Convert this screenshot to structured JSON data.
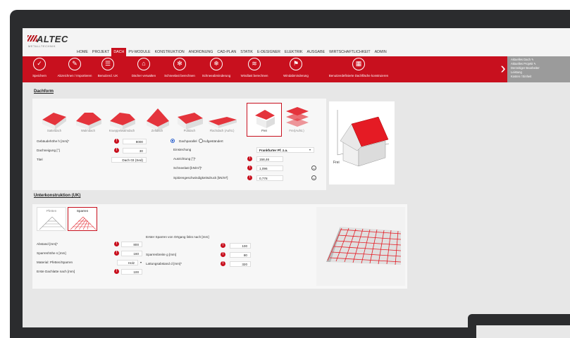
{
  "app": {
    "brand": "ALTEC",
    "brand_sub": "METALLTECHNIK"
  },
  "menu": [
    "HOME",
    "PROJEKT",
    "DACH",
    "PV-MODULE",
    "KONSTRUKTION",
    "ANORDNUNG",
    "CAD-PLAN",
    "STATIK",
    "E-DESIGNER",
    "ELEKTRIK",
    "AUSGABE",
    "WIRTSCHAFTLICHKEIT",
    "ADMIN"
  ],
  "menu_active": "DACH",
  "ribbon": [
    {
      "label": "Speichern",
      "icon": "✓"
    },
    {
      "label": "Abzeichnen / Importieren",
      "icon": "✎"
    },
    {
      "label": "Benutzerd. UK",
      "icon": "☰"
    },
    {
      "label": "Dächer verwalten",
      "icon": "⌂"
    },
    {
      "label": "Schneelast berechnen",
      "icon": "✻"
    },
    {
      "label": "Schneeabminderung",
      "icon": "❄"
    },
    {
      "label": "Windlast berechnen",
      "icon": "≋"
    },
    {
      "label": "Windabminderung",
      "icon": "⚑"
    },
    {
      "label": "Benutzerdefinierte Dachfläche konstruieren",
      "icon": "▦"
    }
  ],
  "right_panel": [
    "Aktuelles Dach ✎",
    "Aktuelles Projekt ✎",
    "Derzeitiger Bearbeiter",
    "Leistung",
    "Kosten / Einheit"
  ],
  "dachform": {
    "title": "Dachform",
    "houses": [
      "Satteldach",
      "Walmdach",
      "Krueppelwalmdach",
      "Zeltdach",
      "Pultdach",
      "Flachdach (Aufst.)",
      "Frei",
      "Frei(Aufst.)"
    ],
    "selected": "Frei",
    "fields_left": [
      {
        "label": "Gebäudehöhe h [mm]*",
        "value": "8000"
      },
      {
        "label": "Dachneigung [°]",
        "value": "30"
      },
      {
        "label": "Titel",
        "value": "Dach 03 (Sed)"
      }
    ],
    "radio1": "Dachparallel",
    "radio2": "Aufgeständert",
    "fields_right": [
      {
        "label": "Einstechung",
        "value": "Frankfurter Pf. z.a."
      },
      {
        "label": "Ausrichtung [°]*",
        "value": "158,46"
      },
      {
        "label": "Schneelast [kN/m²]*",
        "value": "1,096"
      },
      {
        "label": "Spitzengeschwindigkeitsdruck [kN/m²]",
        "value": "0,778"
      }
    ],
    "preview_label": "Frei"
  },
  "uk": {
    "title": "Unterkonstruktion (UK)",
    "tabs": [
      "Pfetten",
      "Sparren"
    ],
    "selected_tab": "Sparren",
    "fields_left": [
      {
        "label": "Abstand [mm]*",
        "value": "800"
      },
      {
        "label": "Sparrenhöhe s [mm]",
        "value": "160"
      },
      {
        "label": "Material: Pfetten/Sparren",
        "value": "Holz"
      },
      {
        "label": "Erste Dachlatte nach [mm]",
        "value": "100"
      }
    ],
    "mid_heading": "Erster Sparren von Ortgang links nach [mm]",
    "fields_mid": [
      {
        "label": "",
        "value": "100"
      },
      {
        "label": "Sparrenbreite g [mm]",
        "value": "80"
      },
      {
        "label": "Lattungsabstand d [mm]*",
        "value": "320"
      }
    ]
  },
  "colors": {
    "accent": "#c8101e",
    "ribbon": "#c8101e",
    "panel_gray": "#9b9b9b"
  }
}
